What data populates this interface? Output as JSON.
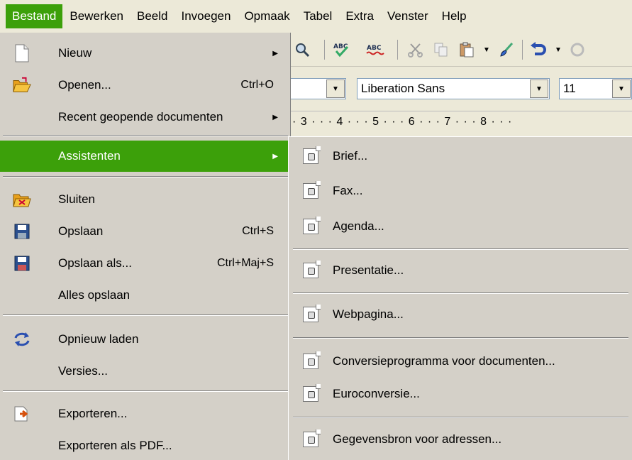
{
  "menubar": {
    "items": [
      {
        "label": "Bestand",
        "u": "B"
      },
      {
        "label": "Bewerken"
      },
      {
        "label": "Beeld"
      },
      {
        "label": "Invoegen"
      },
      {
        "label": "Opmaak"
      },
      {
        "label": "Tabel"
      },
      {
        "label": "Extra"
      },
      {
        "label": "Venster"
      },
      {
        "label": "Help"
      }
    ]
  },
  "toolbar": {
    "font_name": "Liberation Sans",
    "font_size": "11"
  },
  "ruler": {
    "text": "· 3 · · · 4 · · · 5 · · · 6 · · · 7 · · · 8 · · ·"
  },
  "file_menu": {
    "items": [
      {
        "label": "Nieuw",
        "shortcut": "",
        "submenu": true,
        "icon": "new-document-icon"
      },
      {
        "label": "Openen...",
        "shortcut": "Ctrl+O",
        "icon": "open-folder-icon"
      },
      {
        "label": "Recent geopende documenten",
        "submenu": true
      },
      {
        "label": "Assistenten",
        "submenu": true,
        "highlighted": true
      },
      {
        "label": "Sluiten",
        "icon": "close-document-icon"
      },
      {
        "label": "Opslaan",
        "shortcut": "Ctrl+S",
        "icon": "save-icon"
      },
      {
        "label": "Opslaan als...",
        "shortcut": "Ctrl+Maj+S",
        "icon": "save-as-icon"
      },
      {
        "label": "Alles opslaan"
      },
      {
        "label": "Opnieuw laden",
        "icon": "reload-icon"
      },
      {
        "label": "Versies..."
      },
      {
        "label": "Exporteren...",
        "icon": "export-icon"
      },
      {
        "label": "Exporteren als PDF..."
      }
    ]
  },
  "wizards_menu": {
    "items": [
      {
        "label": "Brief..."
      },
      {
        "label": "Fax..."
      },
      {
        "label": "Agenda..."
      },
      {
        "label": "Presentatie..."
      },
      {
        "label": "Webpagina..."
      },
      {
        "label": "Conversieprogramma voor documenten..."
      },
      {
        "label": "Euroconversie..."
      },
      {
        "label": "Gegevensbron voor adressen..."
      }
    ]
  },
  "colors": {
    "highlight": "#3ca00a",
    "menu_bg": "#d4d0c8",
    "bar_bg": "#ece9d8"
  }
}
